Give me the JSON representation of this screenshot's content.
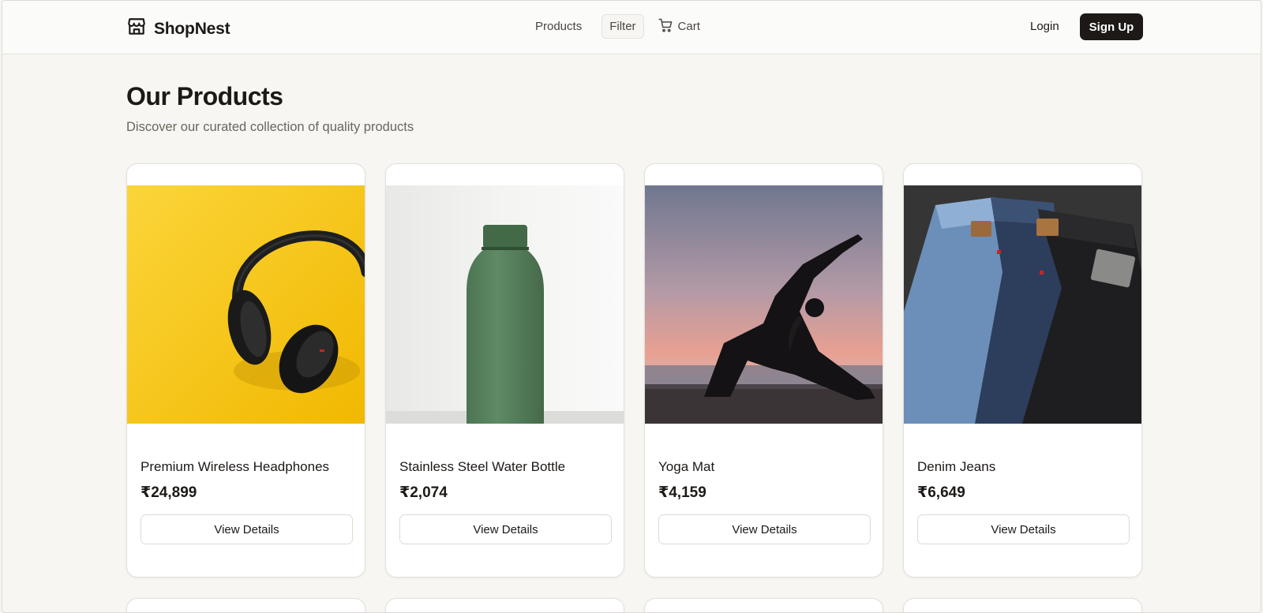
{
  "brand": {
    "name": "ShopNest",
    "icon": "store-icon"
  },
  "nav": {
    "products_label": "Products",
    "filter_label": "Filter",
    "cart_label": "Cart",
    "cart_icon": "cart-icon"
  },
  "auth": {
    "login_label": "Login",
    "signup_label": "Sign Up"
  },
  "page": {
    "title": "Our Products",
    "subtitle": "Discover our curated collection of quality products"
  },
  "products": [
    {
      "name": "Premium Wireless Headphones",
      "price": "₹24,899",
      "button": "View Details",
      "image": "headphones-image"
    },
    {
      "name": "Stainless Steel Water Bottle",
      "price": "₹2,074",
      "button": "View Details",
      "image": "water-bottle-image"
    },
    {
      "name": "Yoga Mat",
      "price": "₹4,159",
      "button": "View Details",
      "image": "yoga-image"
    },
    {
      "name": "Denim Jeans",
      "price": "₹6,649",
      "button": "View Details",
      "image": "jeans-image"
    }
  ],
  "colors": {
    "accent": "#1c1917",
    "background": "#f7f6f2",
    "card": "#ffffff"
  }
}
